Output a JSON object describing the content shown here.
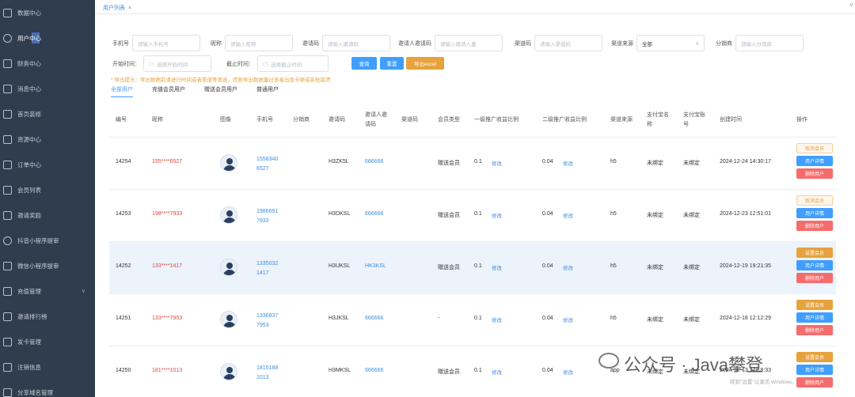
{
  "sidebar": {
    "items": [
      {
        "label": "数据中心",
        "icon": "monitor-icon"
      },
      {
        "label": "用户中心",
        "icon": "user-icon"
      },
      {
        "label": "财务中心",
        "icon": "wallet-icon"
      },
      {
        "label": "消息中心",
        "icon": "message-icon"
      },
      {
        "label": "首页装修",
        "icon": "layout-icon"
      },
      {
        "label": "资源中心",
        "icon": "folder-icon"
      },
      {
        "label": "订单中心",
        "icon": "order-icon"
      },
      {
        "label": "会员列表",
        "icon": "grid-icon"
      },
      {
        "label": "邀请奖励",
        "icon": "gift-icon"
      },
      {
        "label": "抖音小程序提审",
        "icon": "layers-icon"
      },
      {
        "label": "微信小程序提审",
        "icon": "review-icon"
      },
      {
        "label": "充值管理",
        "icon": "recharge-icon"
      },
      {
        "label": "邀请排行榜",
        "icon": "bar-chart-icon"
      },
      {
        "label": "发卡管理",
        "icon": "card-icon"
      },
      {
        "label": "注销信息",
        "icon": "logout-icon"
      },
      {
        "label": "分享域名管理",
        "icon": "domain-icon"
      }
    ]
  },
  "tabbar": {
    "tab_label": "用户列表",
    "close": "×",
    "right": "∨"
  },
  "filters": {
    "phone_label": "手机号",
    "phone_ph": "请输入手机号",
    "nick_label": "昵称",
    "nick_ph": "请输入昵称",
    "invite_label": "邀请码",
    "invite_ph": "请输入邀请码",
    "inviter_label": "邀请人邀请码",
    "inviter_ph": "请输入邀请人邀",
    "channel_label": "渠道码",
    "channel_ph": "请输入渠道码",
    "source_label": "渠道来源",
    "source_value": "全部",
    "dist_label": "分销商",
    "dist_ph": "请输入分销商",
    "start_label": "开始时间：",
    "start_ph": "选择开始时间",
    "end_label": "截止时间：",
    "end_ph": "选择截止时间",
    "query_btn": "查询",
    "reset_btn": "重置",
    "export_btn": "导出excel",
    "warning": "* 导出提示：导出数据前请进行时间或者渠道等筛选，否则导出数据量过多易出现卡顿或系统崩溃"
  },
  "subtabs": [
    "全部用户",
    "充值会员用户",
    "赠送会员用户",
    "普通用户"
  ],
  "table": {
    "headers": {
      "id": "编号",
      "nick": "昵称",
      "avatar": "图像",
      "phone": "手机号",
      "dist": "分销商",
      "invite": "邀请码",
      "inviter": "邀请人邀请码",
      "channel": "渠道码",
      "member": "会员类型",
      "ratio1": "一级推广收益比例",
      "ratio2": "二级推广收益比例",
      "source": "渠道来源",
      "payname": "支付宝名称",
      "payacct": "支付宝账号",
      "created": "创建时间",
      "op": "操作"
    },
    "edit_label": "修改",
    "rows": [
      {
        "id": "14254",
        "nick": "155****6527",
        "phone1": "1558340",
        "phone2": "6527",
        "invite": "H3ZK5L",
        "inviter": "666666",
        "member": "赠送会员",
        "r1": "0.1",
        "r2": "0.04",
        "source": "h5",
        "payname": "未绑定",
        "payacct": "未绑定",
        "created": "2024-12-24 14:30:17",
        "ops": [
          "取消会员",
          "用户详情",
          "删除用户"
        ],
        "op_style": "outline"
      },
      {
        "id": "14253",
        "nick": "198****7933",
        "phone1": "1986691",
        "phone2": "7933",
        "invite": "H3DKSL",
        "inviter": "666666",
        "member": "赠送会员",
        "r1": "0.1",
        "r2": "0.04",
        "source": "h5",
        "payname": "未绑定",
        "payacct": "未绑定",
        "created": "2024-12-23 12:51:01",
        "ops": [
          "取消会员",
          "用户详情",
          "删除用户"
        ],
        "op_style": "outline"
      },
      {
        "id": "14252",
        "nick": "133****1417",
        "phone1": "1335032",
        "phone2": "1417",
        "invite": "H3UKSL",
        "inviter": "HK3KSL",
        "member": "赠送会员",
        "r1": "0.1",
        "r2": "0.04",
        "source": "h5",
        "payname": "未绑定",
        "payacct": "未绑定",
        "created": "2024-12-19 19:21:35",
        "ops": [
          "设置会员",
          "用户详情",
          "删除用户"
        ],
        "op_style": "orange"
      },
      {
        "id": "14251",
        "nick": "133****7953",
        "phone1": "1336837",
        "phone2": "7953",
        "invite": "H3JKSL",
        "inviter": "666666",
        "member": "-",
        "r1": "0.1",
        "r2": "0.04",
        "source": "h5",
        "payname": "未绑定",
        "payacct": "未绑定",
        "created": "2024-12-18 12:12:29",
        "ops": [
          "设置会员",
          "用户详情",
          "删除用户"
        ],
        "op_style": "orange"
      },
      {
        "id": "14250",
        "nick": "181****1013",
        "phone1": "1815188",
        "phone2": "1013",
        "invite": "H3MKSL",
        "inviter": "666666",
        "member": "赠送会员",
        "r1": "0.1",
        "r2": "0.04",
        "source": "app",
        "payname": "未绑定",
        "payacct": "未绑定",
        "created": "2024-12-13 14:18:33",
        "ops": [
          "设置会员",
          "用户详情",
          "删除用户"
        ],
        "op_style": "orange"
      }
    ]
  },
  "watermark": {
    "main": "公众号 · Java攀登",
    "sub": "转到\"设置\"以激活 Windows。"
  }
}
